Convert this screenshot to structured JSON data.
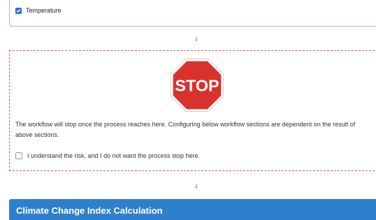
{
  "temperature_option": {
    "label": "Temperature",
    "checked": true
  },
  "stop_section": {
    "sign_text": "STOP",
    "description": "The workflow will stop once the process reaches here. Configuring below workflow sections are dependent on the result of above sections.",
    "risk_checkbox_label": "I understand the risk, and I do not want the process stop here.",
    "risk_checked": false
  },
  "flow_arrow": "↓",
  "next_section": {
    "title": "Climate Change Index Calculation"
  },
  "colors": {
    "section_header": "#2f80cc",
    "stop_red": "#d9322c",
    "stop_border_dashed": "#e05a5a",
    "checkbox_blue": "#2d7ad9"
  }
}
